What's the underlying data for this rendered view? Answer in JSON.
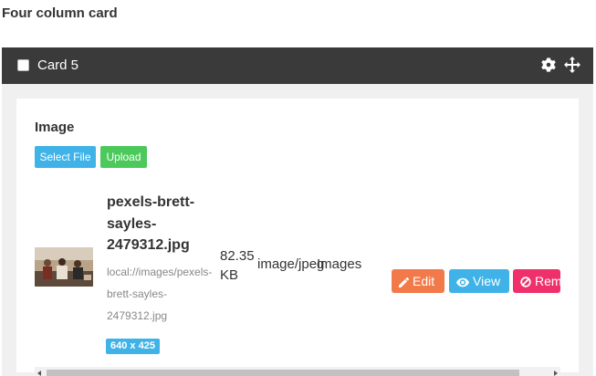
{
  "page": {
    "title": "Four column card"
  },
  "card": {
    "title": "Card 5",
    "checkbox_checked": false,
    "icons": [
      "gear-icon",
      "move-icon"
    ]
  },
  "field": {
    "label": "Image",
    "select_label": "Select File",
    "upload_label": "Upload"
  },
  "file": {
    "name": "pexels-brett-sayles-2479312.jpg",
    "path": "local://images/pexels-brett-sayles-2479312.jpg",
    "dimensions": "640 x 425",
    "size": "82.35 KB",
    "mime": "image/jpeg",
    "category": "Images"
  },
  "actions": {
    "edit_label": "Edit",
    "view_label": "View",
    "remove_label": "Remove"
  },
  "colors": {
    "header_bg": "#3a3a3a",
    "primary": "#3fb3e8",
    "success": "#4cc95b",
    "warning": "#f27a4a",
    "danger": "#f0306a"
  }
}
